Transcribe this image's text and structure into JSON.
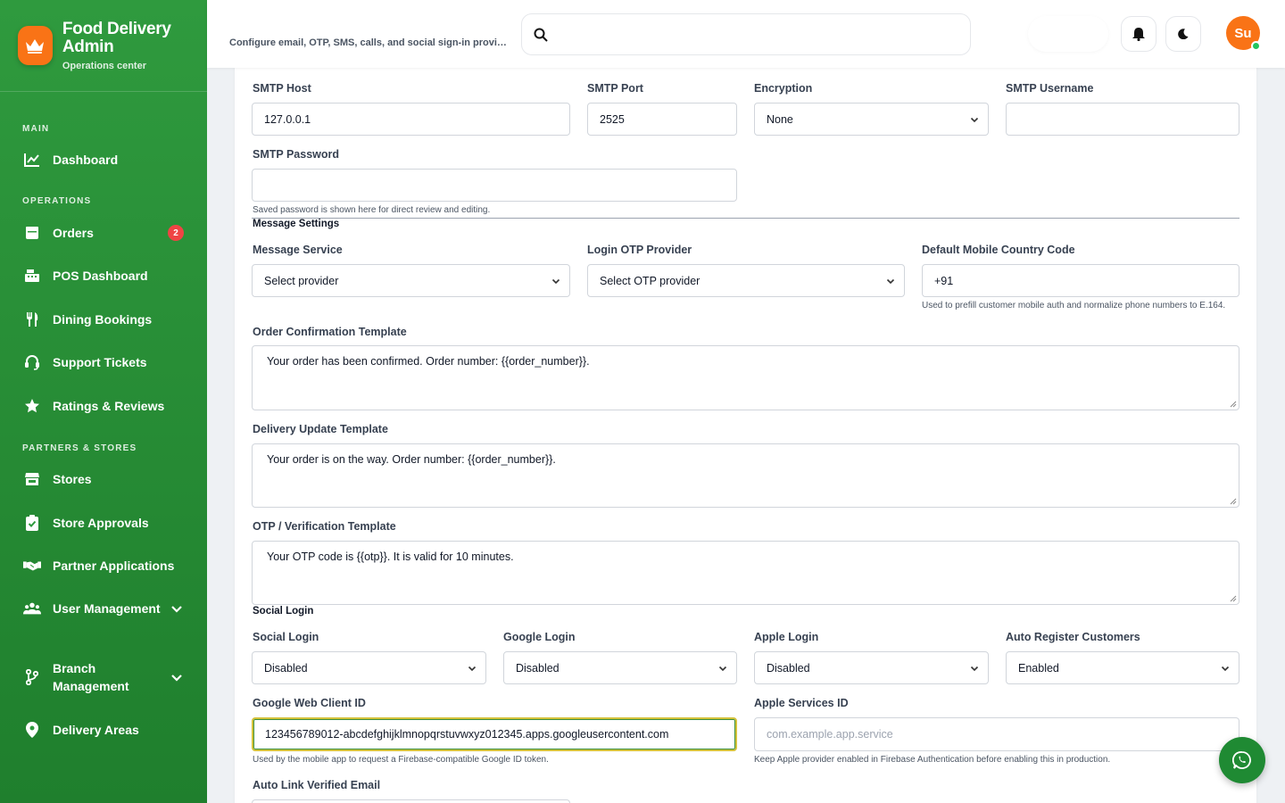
{
  "brand": {
    "title": "Food Delivery Admin",
    "subtitle": "Operations center",
    "logo_icon": "crown-icon"
  },
  "sidebar": {
    "sections": {
      "main": "MAIN",
      "operations": "OPERATIONS",
      "partners": "PARTNERS & STORES"
    },
    "items": [
      {
        "label": "Dashboard",
        "icon": "chart-line-icon"
      },
      {
        "label": "Orders",
        "icon": "cart-icon",
        "badge": "2"
      },
      {
        "label": "POS Dashboard",
        "icon": "cash-register-icon"
      },
      {
        "label": "Dining Bookings",
        "icon": "utensils-icon"
      },
      {
        "label": "Support Tickets",
        "icon": "headset-icon"
      },
      {
        "label": "Ratings & Reviews",
        "icon": "star-icon"
      },
      {
        "label": "Stores",
        "icon": "store-icon"
      },
      {
        "label": "Store Approvals",
        "icon": "clipboard-check-icon"
      },
      {
        "label": "Partner Applications",
        "icon": "handshake-icon"
      },
      {
        "label": "User Management",
        "icon": "users-icon"
      },
      {
        "label": "Branch Management",
        "icon": "branch-icon"
      },
      {
        "label": "Delivery Areas",
        "icon": "map-pin-icon"
      }
    ]
  },
  "topbar": {
    "description": "Configure email, OTP, SMS, calls, and social sign-in providers",
    "search_placeholder": "",
    "avatar_initials": "Su"
  },
  "smtp": {
    "host": {
      "label": "SMTP Host",
      "value": "127.0.0.1"
    },
    "port": {
      "label": "SMTP Port",
      "value": "2525"
    },
    "encryption": {
      "label": "Encryption",
      "value": "None"
    },
    "username": {
      "label": "SMTP Username",
      "value": ""
    },
    "password": {
      "label": "SMTP Password",
      "value": "",
      "help": "Saved password is shown here for direct review and editing."
    }
  },
  "message_settings": {
    "title": "Message Settings",
    "service": {
      "label": "Message Service",
      "value": "Select provider"
    },
    "otp_provider": {
      "label": "Login OTP Provider",
      "value": "Select OTP provider"
    },
    "country_code": {
      "label": "Default Mobile Country Code",
      "value": "+91",
      "help": "Used to prefill customer mobile auth and normalize phone numbers to E.164."
    },
    "order_template": {
      "label": "Order Confirmation Template",
      "value": "Your order has been confirmed. Order number: {{order_number}}."
    },
    "delivery_template": {
      "label": "Delivery Update Template",
      "value": "Your order is on the way. Order number: {{order_number}}."
    },
    "otp_template": {
      "label": "OTP / Verification Template",
      "value": "Your OTP code is {{otp}}. It is valid for 10 minutes."
    }
  },
  "social_login": {
    "title": "Social Login",
    "social": {
      "label": "Social Login",
      "value": "Disabled"
    },
    "google": {
      "label": "Google Login",
      "value": "Disabled"
    },
    "apple": {
      "label": "Apple Login",
      "value": "Disabled"
    },
    "auto_register": {
      "label": "Auto Register Customers",
      "value": "Enabled"
    },
    "google_client": {
      "label": "Google Web Client ID",
      "value": "123456789012-abcdefghijklmnopqrstuvwxyz012345.apps.googleusercontent.com",
      "help": "Used by the mobile app to request a Firebase-compatible Google ID token."
    },
    "apple_service": {
      "label": "Apple Services ID",
      "placeholder": "com.example.app.service",
      "help": "Keep Apple provider enabled in Firebase Authentication before enabling this in production."
    },
    "auto_link": {
      "label": "Auto Link Verified Email"
    }
  },
  "colors": {
    "sidebar": "#2f9a3e",
    "accent": "#f97316",
    "badge": "#ef4444",
    "fab": "#1f8a33"
  }
}
